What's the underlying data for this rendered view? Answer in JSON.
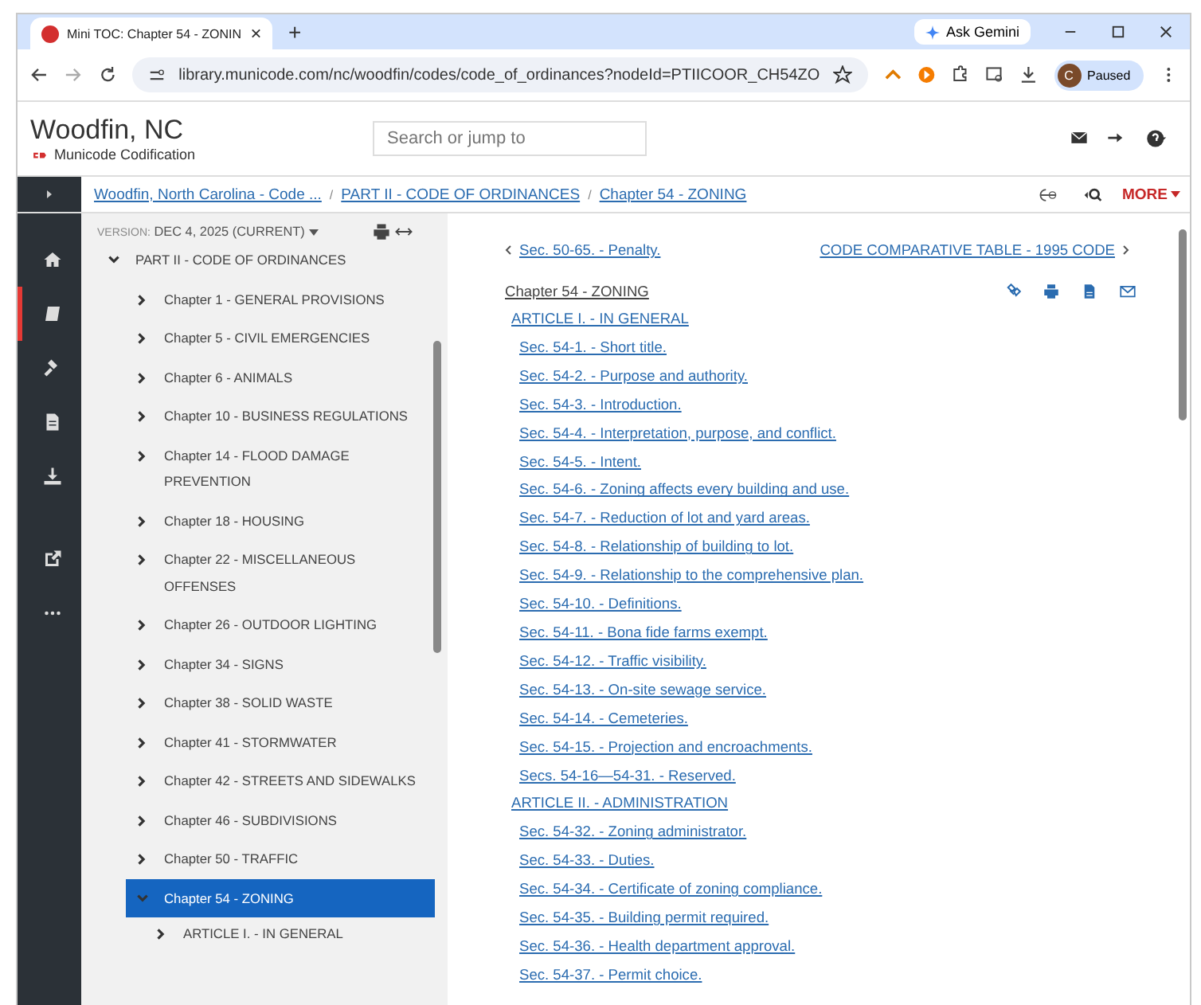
{
  "browser": {
    "tab_title": "Mini TOC: Chapter 54 - ZONIN",
    "new_tab": "+",
    "ask": "Ask Gemini",
    "url": "library.municode.com/nc/woodfin/codes/code_of_ordinances?nodeId=PTIICOOR_CH54ZO",
    "profile_initial": "C",
    "profile_status": "Paused"
  },
  "header": {
    "title": "Woodfin, NC",
    "brand": "Municode Codification",
    "search": {
      "placeholder": "Search or jump to"
    }
  },
  "breadcrumbs": [
    {
      "label": "Woodfin, North Carolina - Code ..."
    },
    {
      "separator": "/",
      "label": "PART II - CODE OF ORDINANCES"
    },
    {
      "separator": "/",
      "label": "Chapter 54 - ZONING"
    }
  ],
  "more": "MORE",
  "rail": [
    {
      "kind": "home",
      "selected": false
    },
    {
      "kind": "book",
      "selected": true
    },
    {
      "kind": "gavel",
      "selected": false
    },
    {
      "kind": "document",
      "selected": false
    },
    {
      "kind": "download",
      "selected": false
    },
    {
      "kind": "external",
      "selected": false
    },
    {
      "kind": "more",
      "selected": false
    }
  ],
  "toc": {
    "version_label": "VERSION:",
    "version": "DEC 4, 2025 (CURRENT)",
    "root": {
      "label": "PART II - CODE OF ORDINANCES",
      "expanded": true,
      "children": [
        {
          "label": "Chapter 1 - GENERAL PROVISIONS",
          "expanded": false,
          "selected": false
        },
        {
          "label": "Chapter 5 - CIVIL EMERGENCIES",
          "expanded": false,
          "selected": false
        },
        {
          "label": "Chapter 6 - ANIMALS",
          "expanded": false,
          "selected": false
        },
        {
          "label": "Chapter 10 - BUSINESS REGULATIONS",
          "expanded": false,
          "selected": false
        },
        {
          "label": "Chapter 14 - FLOOD DAMAGE PREVENTION",
          "expanded": false,
          "selected": false
        },
        {
          "label": "Chapter 18 - HOUSING",
          "expanded": false,
          "selected": false
        },
        {
          "label": "Chapter 22 - MISCELLANEOUS OFFENSES",
          "expanded": false,
          "selected": false
        },
        {
          "label": "Chapter 26 - OUTDOOR LIGHTING",
          "expanded": false,
          "selected": false
        },
        {
          "label": "Chapter 34 - SIGNS",
          "expanded": false,
          "selected": false
        },
        {
          "label": "Chapter 38 - SOLID WASTE",
          "expanded": false,
          "selected": false
        },
        {
          "label": "Chapter 41 - STORMWATER",
          "expanded": false,
          "selected": false
        },
        {
          "label": "Chapter 42 - STREETS AND SIDEWALKS",
          "expanded": false,
          "selected": false
        },
        {
          "label": "Chapter 46 - SUBDIVISIONS",
          "expanded": false,
          "selected": false
        },
        {
          "label": "Chapter 50 - TRAFFIC",
          "expanded": false,
          "selected": false
        },
        {
          "label": "Chapter 54 - ZONING",
          "expanded": true,
          "selected": true,
          "children": [
            {
              "label": "ARTICLE I. - IN GENERAL",
              "expanded": false,
              "selected": false
            }
          ]
        }
      ]
    }
  },
  "content": {
    "prev": "Sec. 50-65. - Penalty.",
    "next": "CODE COMPARATIVE TABLE - 1995 CODE",
    "title": "Chapter 54 - ZONING",
    "entries": [
      {
        "kind": "article",
        "text": "ARTICLE I. - IN GENERAL"
      },
      {
        "kind": "section",
        "text": "Sec. 54-1. - Short title."
      },
      {
        "kind": "section",
        "text": "Sec. 54-2. - Purpose and authority."
      },
      {
        "kind": "section",
        "text": "Sec. 54-3. - Introduction."
      },
      {
        "kind": "section",
        "text": "Sec. 54-4. - Interpretation, purpose, and conflict."
      },
      {
        "kind": "section",
        "text": "Sec. 54-5. - Intent."
      },
      {
        "kind": "section",
        "text": "Sec. 54-6. - Zoning affects every building and use."
      },
      {
        "kind": "section",
        "text": "Sec. 54-7. - Reduction of lot and yard areas."
      },
      {
        "kind": "section",
        "text": "Sec. 54-8. - Relationship of building to lot."
      },
      {
        "kind": "section",
        "text": "Sec. 54-9. - Relationship to the comprehensive plan."
      },
      {
        "kind": "section",
        "text": "Sec. 54-10. - Definitions."
      },
      {
        "kind": "section",
        "text": "Sec. 54-11. - Bona fide farms exempt."
      },
      {
        "kind": "section",
        "text": "Sec. 54-12. - Traffic visibility."
      },
      {
        "kind": "section",
        "text": "Sec. 54-13. - On-site sewage service."
      },
      {
        "kind": "section",
        "text": "Sec. 54-14. - Cemeteries."
      },
      {
        "kind": "section",
        "text": "Sec. 54-15. - Projection and encroachments."
      },
      {
        "kind": "section",
        "text": "Secs. 54-16—54-31. - Reserved."
      },
      {
        "kind": "article",
        "text": "ARTICLE II. - ADMINISTRATION"
      },
      {
        "kind": "section",
        "text": "Sec. 54-32. - Zoning administrator."
      },
      {
        "kind": "section",
        "text": "Sec. 54-33. - Duties."
      },
      {
        "kind": "section",
        "text": "Sec. 54-34. - Certificate of zoning compliance."
      },
      {
        "kind": "section",
        "text": "Sec. 54-35. - Building permit required."
      },
      {
        "kind": "section",
        "text": "Sec. 54-36. - Health department approval."
      },
      {
        "kind": "section",
        "text": "Sec. 54-37. - Permit choice."
      }
    ]
  }
}
